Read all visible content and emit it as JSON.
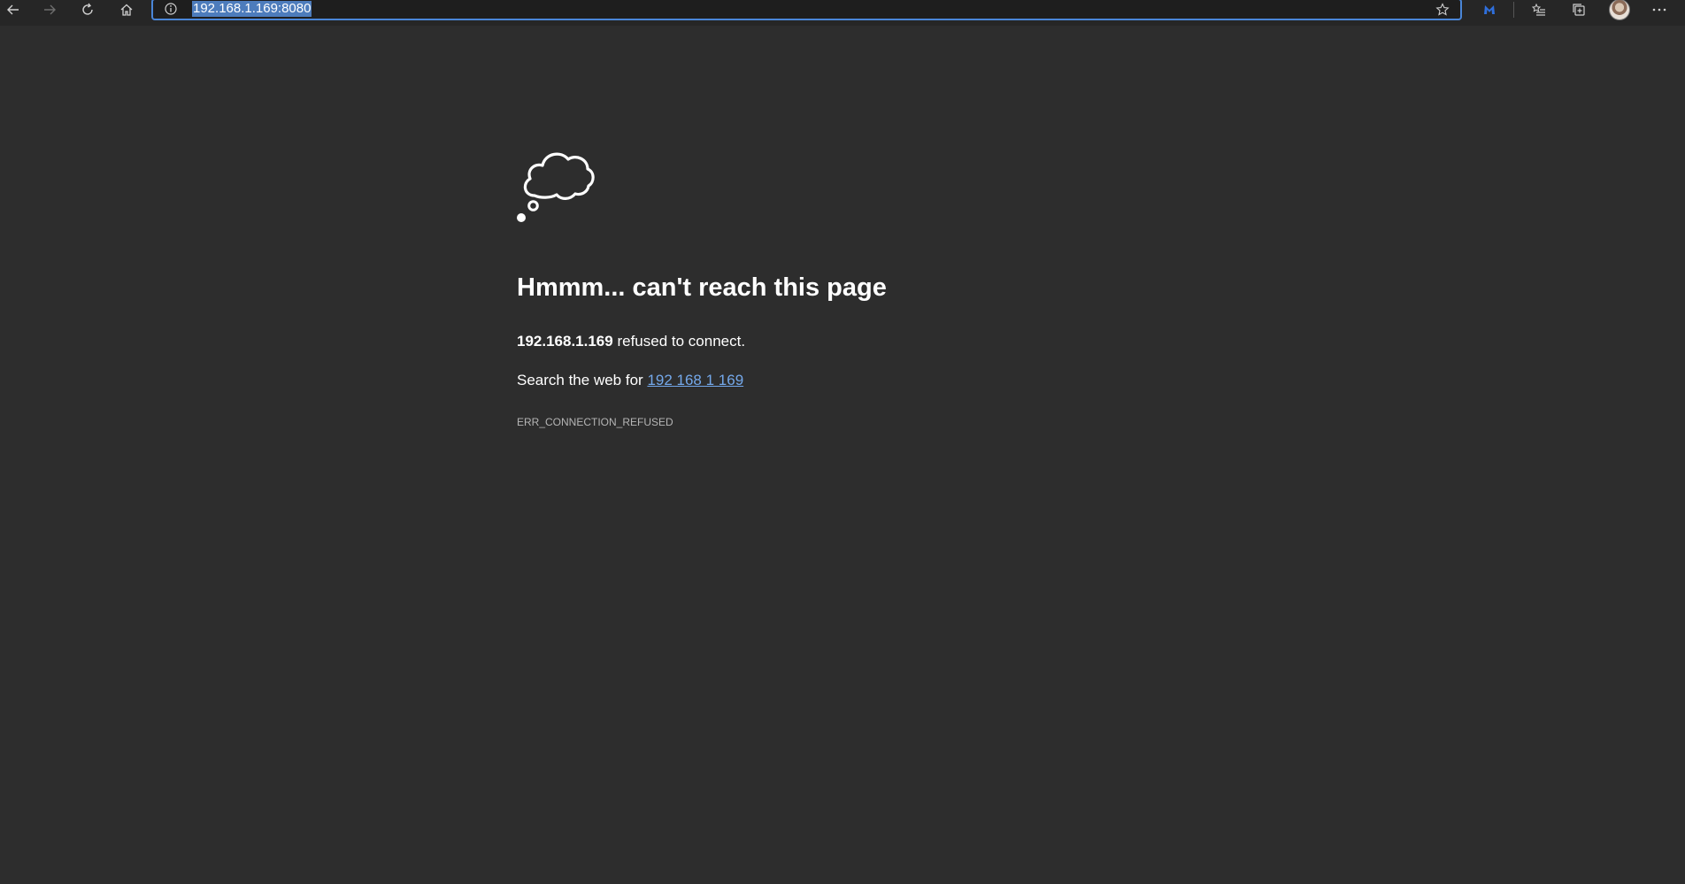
{
  "browser": {
    "address_bar": {
      "url": "192.168.1.169:8080"
    },
    "icons": {
      "back": "back-arrow-icon",
      "forward": "forward-arrow-icon",
      "refresh": "refresh-icon",
      "home": "home-icon",
      "info": "info-icon",
      "favorite": "star-icon",
      "extension": "malwarebytes-extension-icon",
      "favorites_list": "favorites-list-icon",
      "collections": "collections-icon",
      "profile": "profile-avatar",
      "more": "more-options-icon"
    },
    "colors": {
      "toolbar_bg": "#262626",
      "page_bg": "#2d2d2d",
      "address_border": "#4a86d8",
      "selection": "#4d7cbc",
      "link": "#74a8ea",
      "extension_blue": "#2f6fdc"
    }
  },
  "error_page": {
    "icon": "thought-cloud-icon",
    "heading": "Hmmm... can't reach this page",
    "host": "192.168.1.169",
    "refused_text": "refused to connect.",
    "search_prefix": "Search the web for",
    "search_link": "192 168 1 169",
    "error_code": "ERR_CONNECTION_REFUSED"
  }
}
